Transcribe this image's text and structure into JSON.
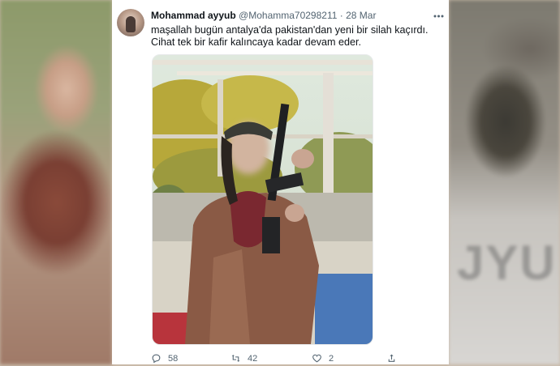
{
  "tweet": {
    "author_name": "Mohammad ayyub",
    "author_handle": "@Mohamma70298211",
    "separator": "·",
    "date": "28 Mar",
    "text": "maşallah bugün antalya'da pakistan'dan yeni bir silah kaçırdı. Cihat tek bir kafir kalıncaya kadar devam eder.",
    "more_icon": "more-horizontal-icon"
  },
  "actions": {
    "reply_count": "58",
    "retweet_count": "42",
    "like_count": "2",
    "reply_icon": "reply-icon",
    "retweet_icon": "retweet-icon",
    "like_icon": "heart-icon",
    "share_icon": "share-icon"
  },
  "background": {
    "right_panel_text": "JYU"
  },
  "colors": {
    "text_primary": "#0f1419",
    "text_secondary": "#536471",
    "card_bg": "#ffffff",
    "border": "#e7e9ea"
  }
}
